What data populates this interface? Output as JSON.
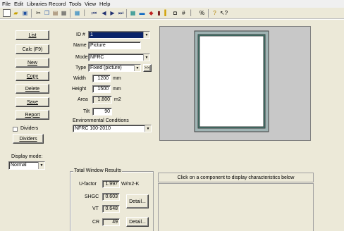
{
  "menu": [
    "File",
    "Edit",
    "Libraries",
    "Record",
    "Tools",
    "View",
    "Help"
  ],
  "sidebar": {
    "list": "List",
    "calc": "Calc (F9)",
    "new": "New",
    "copy": "Copy",
    "delete": "Delete",
    "save": "Save",
    "report": "Report",
    "dividers_checkbox": "Dividers",
    "dividers_button": "Dividers",
    "display_mode_label": "Display mode:",
    "display_mode_value": "Normal"
  },
  "form": {
    "id_label": "ID #",
    "id_value": "1",
    "name_label": "Name",
    "name_value": "Picture",
    "mode_label": "Mode",
    "mode_value": "NFRC",
    "type_label": "Type",
    "type_value": "Fixed (picture)",
    "type_more": ">>|",
    "width_label": "Width",
    "width_value": "1200",
    "width_unit": "mm",
    "height_label": "Height",
    "height_value": "1500",
    "height_unit": "mm",
    "area_label": "Area",
    "area_value": "1.800",
    "area_unit": "m2",
    "tilt_label": "Tilt",
    "tilt_value": "90",
    "env_label": "Environmental Conditions",
    "env_value": "NFRC 100-2010"
  },
  "results": {
    "title": "Total Window Results",
    "ufactor_label": "U-factor",
    "ufactor_value": "1.997",
    "ufactor_unit": "W/m2-K",
    "shgc_label": "SHGC",
    "shgc_value": "0.603",
    "vt_label": "VT",
    "vt_value": "0.648",
    "cr_label": "CR",
    "cr_value": "49",
    "detail": "Detail..."
  },
  "info": {
    "message": "Click on a component to display characteristics below"
  }
}
